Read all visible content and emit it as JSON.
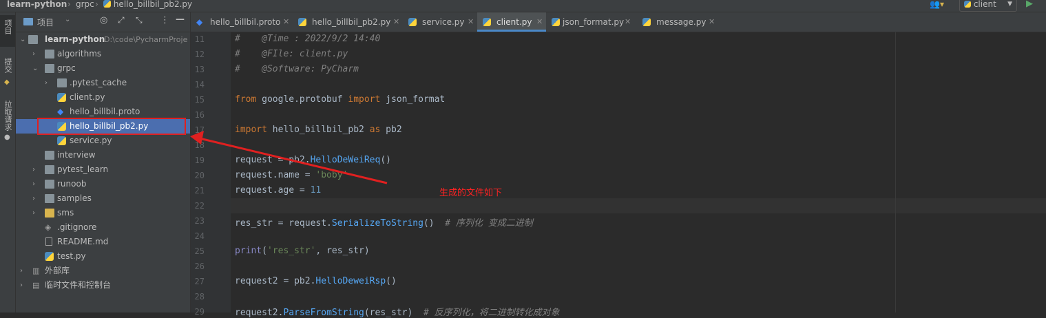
{
  "breadcrumb": {
    "project": "learn-python",
    "folder": "grpc",
    "file": "hello_billbil_pb2.py"
  },
  "run_config": "client",
  "side_tabs": [
    "项目",
    "提交",
    "拉取请求"
  ],
  "project_panel": {
    "view_label": "项目"
  },
  "tree": [
    {
      "label": "learn-python",
      "path": "D:\\code\\PycharmProje"
    },
    {
      "label": "algorithms"
    },
    {
      "label": "grpc"
    },
    {
      "label": ".pytest_cache"
    },
    {
      "label": "client.py"
    },
    {
      "label": "hello_billbil.proto"
    },
    {
      "label": "hello_billbil_pb2.py"
    },
    {
      "label": "service.py"
    },
    {
      "label": "interview"
    },
    {
      "label": "pytest_learn"
    },
    {
      "label": "runoob"
    },
    {
      "label": "samples"
    },
    {
      "label": "sms"
    },
    {
      "label": ".gitignore"
    },
    {
      "label": "README.md"
    },
    {
      "label": "test.py"
    },
    {
      "label": "外部库"
    },
    {
      "label": "临时文件和控制台"
    }
  ],
  "tabs": [
    {
      "label": "hello_billbil.proto"
    },
    {
      "label": "hello_billbil_pb2.py"
    },
    {
      "label": "service.py"
    },
    {
      "label": "client.py"
    },
    {
      "label": "json_format.py"
    },
    {
      "label": "message.py"
    }
  ],
  "line_numbers": [
    "11",
    "12",
    "13",
    "14",
    "15",
    "16",
    "17",
    "18",
    "19",
    "20",
    "21",
    "22",
    "23",
    "24",
    "25",
    "26",
    "27",
    "28",
    "29"
  ],
  "code": {
    "l11": "#    @Time : 2022/9/2 14:40",
    "l12": "#    @FIle: client.py",
    "l13": "#    @Software: PyCharm",
    "l15_kw1": "from",
    "l15_mod": " google.protobuf ",
    "l15_kw2": "import",
    "l15_rest": " json_format",
    "l17_kw1": "import",
    "l17_mod": " hello_billbil_pb2 ",
    "l17_kw2": "as",
    "l17_rest": " pb2",
    "l19_a": "request = pb2.",
    "l19_b": "HelloDeWeiReq",
    "l19_c": "()",
    "l20_a": "request.name = ",
    "l20_b": "'boby'",
    "l21_a": "request.age = ",
    "l21_b": "11",
    "l23_a": "res_str = request.",
    "l23_b": "SerializeToString",
    "l23_c": "()  ",
    "l23_d": "# 序列化 变成二进制",
    "l25_a": "print",
    "l25_b": "(",
    "l25_c": "'res_str'",
    "l25_d": ", res_str)",
    "l27_a": "request2 = pb2.",
    "l27_b": "HelloDeweiRsp",
    "l27_c": "()",
    "l29_a": "request2.",
    "l29_b": "ParseFromString",
    "l29_c": "(res_str)  ",
    "l29_d": "# 反序列化，将二进制转化成对象"
  },
  "annotation_text": "生成的文件如下",
  "colors": {
    "annotation": "#ff2222",
    "selection": "#4b6eaf",
    "tab_underline": "#4a88c7"
  }
}
